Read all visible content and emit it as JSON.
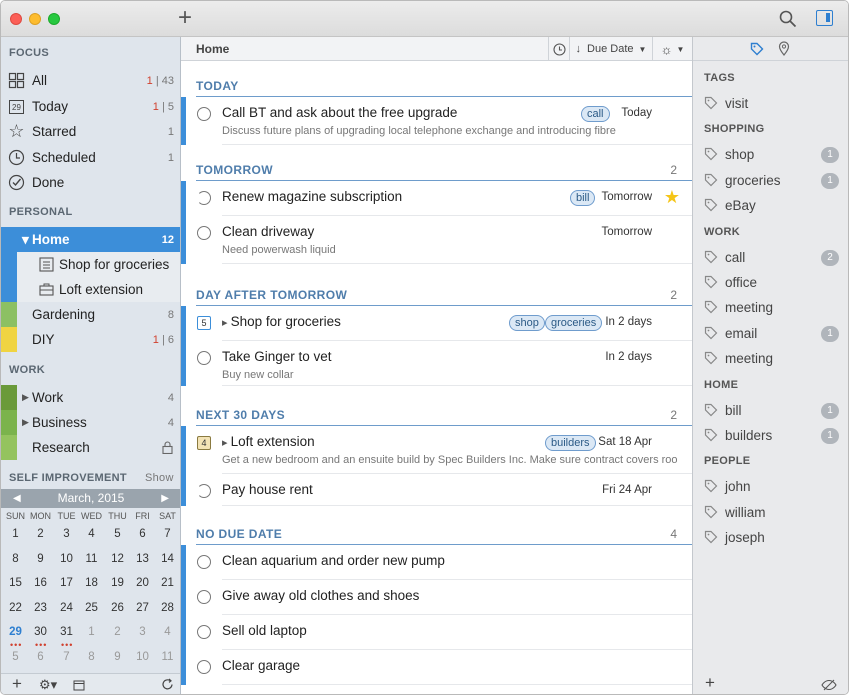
{
  "sidebar": {
    "focus_label": "FOCUS",
    "focus": [
      {
        "label": "All",
        "count_red": "1",
        "count_sep": "|",
        "count": "43",
        "icon": "grid-icon"
      },
      {
        "label": "Today",
        "count_red": "1",
        "count_sep": "|",
        "count": "5",
        "icon": "calendar-29-icon",
        "icon_text": "29"
      },
      {
        "label": "Starred",
        "count": "1",
        "icon": "star-icon"
      },
      {
        "label": "Scheduled",
        "count": "1",
        "icon": "clock-icon"
      },
      {
        "label": "Done",
        "count": "",
        "icon": "check-circle-icon"
      }
    ],
    "personal_label": "PERSONAL",
    "personal": [
      {
        "label": "Home",
        "count": "12",
        "selected": true
      },
      {
        "label": "Shop for groceries"
      },
      {
        "label": "Loft extension"
      },
      {
        "label": "Gardening",
        "count": "8"
      },
      {
        "label": "DIY",
        "count_red": "1",
        "count_sep": "|",
        "count": "6"
      }
    ],
    "work_label": "WORK",
    "work": [
      {
        "label": "Work",
        "count": "4"
      },
      {
        "label": "Business",
        "count": "4"
      },
      {
        "label": "Research",
        "count": ""
      }
    ],
    "self_label": "SELF IMPROVEMENT",
    "show_label": "Show",
    "colors": {
      "home": "#3c8ed9",
      "gardening": "#8cc063",
      "diy": "#f0d442",
      "work": "#6a9a3a",
      "business": "#7bb34c",
      "research": "#94c35e"
    }
  },
  "calendar": {
    "month": "March, 2015",
    "dows": [
      "SUN",
      "MON",
      "TUE",
      "WED",
      "THU",
      "FRI",
      "SAT"
    ],
    "weeks": [
      [
        "1",
        "2",
        "3",
        "4",
        "5",
        "6",
        "7"
      ],
      [
        "8",
        "9",
        "10",
        "11",
        "12",
        "13",
        "14"
      ],
      [
        "15",
        "16",
        "17",
        "18",
        "19",
        "20",
        "21"
      ],
      [
        "22",
        "23",
        "24",
        "25",
        "26",
        "27",
        "28"
      ],
      [
        "29",
        "30",
        "31",
        "1",
        "2",
        "3",
        "4"
      ],
      [
        "5",
        "6",
        "7",
        "8",
        "9",
        "10",
        "11"
      ]
    ],
    "today": "29"
  },
  "main": {
    "title": "Home",
    "sort_label": "Due Date",
    "groups": [
      {
        "label": "TODAY",
        "count": ""
      },
      {
        "label": "TOMORROW",
        "count": "2"
      },
      {
        "label": "DAY AFTER TOMORROW",
        "count": "2"
      },
      {
        "label": "NEXT 30 DAYS",
        "count": "2"
      },
      {
        "label": "NO DUE DATE",
        "count": "4"
      }
    ],
    "tasks": [
      {
        "title": "Call BT and ask about the free upgrade",
        "note": "Discuss future plans of upgrading local telephone exchange and introducing fibre",
        "tags": [
          "call"
        ],
        "due": "Today"
      },
      {
        "title": "Renew magazine subscription",
        "tags": [
          "bill"
        ],
        "due": "Tomorrow",
        "starred": true
      },
      {
        "title": "Clean driveway",
        "note": "Need powerwash liquid",
        "due": "Tomorrow"
      },
      {
        "title": "Shop for groceries",
        "tags": [
          "shop",
          "groceries"
        ],
        "due": "In 2 days",
        "badge": "5"
      },
      {
        "title": "Take Ginger to vet",
        "note": "Buy new collar",
        "due": "In 2 days"
      },
      {
        "title": "Loft extension",
        "note": "Get a new bedroom and an ensuite build by Spec Builders Inc. Make sure contract covers roo",
        "tags": [
          "builders"
        ],
        "due": "Sat 18 Apr",
        "badge": "4"
      },
      {
        "title": "Pay house rent",
        "due": "Fri 24 Apr"
      },
      {
        "title": "Clean aquarium and order new pump"
      },
      {
        "title": "Give away old clothes and shoes"
      },
      {
        "title": "Sell old laptop"
      },
      {
        "title": "Clear garage"
      }
    ]
  },
  "tags_panel": {
    "sections": [
      {
        "label": "TAGS",
        "items": [
          {
            "label": "visit"
          }
        ]
      },
      {
        "label": "SHOPPING",
        "items": [
          {
            "label": "shop",
            "count": "1"
          },
          {
            "label": "groceries",
            "count": "1"
          },
          {
            "label": "eBay"
          }
        ]
      },
      {
        "label": "WORK",
        "items": [
          {
            "label": "call",
            "count": "2"
          },
          {
            "label": "office"
          },
          {
            "label": "meeting"
          },
          {
            "label": "email",
            "count": "1"
          },
          {
            "label": "meeting"
          }
        ]
      },
      {
        "label": "HOME",
        "items": [
          {
            "label": "bill",
            "count": "1"
          },
          {
            "label": "builders",
            "count": "1"
          }
        ]
      },
      {
        "label": "PEOPLE",
        "items": [
          {
            "label": "john"
          },
          {
            "label": "william"
          },
          {
            "label": "joseph"
          }
        ]
      }
    ]
  }
}
